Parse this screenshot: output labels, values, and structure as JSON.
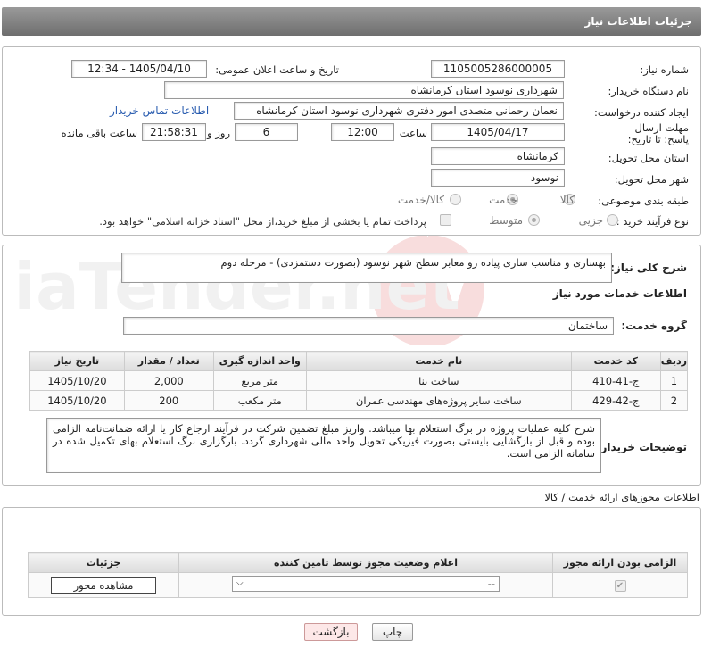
{
  "header": {
    "title": "جزئیات اطلاعات نیاز"
  },
  "form": {
    "need_no_label": "شماره نیاز:",
    "need_no": "1105005286000005",
    "announce_label": "تاریخ و ساعت اعلان عمومی:",
    "announce": "1405/04/10 - 12:34",
    "buyer_org_label": "نام دستگاه خریدار:",
    "buyer_org": "شهرداری نوسود استان کرمانشاه",
    "creator_label": "ایجاد کننده درخواست:",
    "creator": "نعمان رحمانی متصدی امور دفتری شهرداری نوسود استان کرمانشاه",
    "contact_link": "اطلاعات تماس خریدار",
    "deadline_label": "مهلت ارسال پاسخ: تا تاریخ:",
    "deadline_date": "1405/04/17",
    "time_label": "ساعت",
    "deadline_time": "12:00",
    "days": "6",
    "days_label": "روز و",
    "remaining": "21:58:31",
    "remaining_label": "ساعت باقی مانده",
    "province_label": "استان محل تحویل:",
    "province": "کرمانشاه",
    "city_label": "شهر محل تحویل:",
    "city": "نوسود",
    "category_label": "طبقه بندی موضوعی:",
    "cat_goods": "کالا",
    "cat_service": "خدمت",
    "cat_both": "کالا/خدمت",
    "process_label": "نوع فرآیند خرید :",
    "proc_small": "جزیی",
    "proc_medium": "متوسط",
    "payment_note": "پرداخت تمام یا بخشی از مبلغ خرید،از محل \"اسناد خزانه اسلامی\" خواهد بود."
  },
  "watermark": {
    "text": "AriaTender.net"
  },
  "description": {
    "label": "شرح کلی نیاز:",
    "value": "بهسازی و مناسب سازی پیاده رو معابر سطح شهر نوسود (بصورت دستمزدی) - مرحله دوم"
  },
  "services": {
    "title": "اطلاعات خدمات مورد نیاز",
    "group_label": "گروه خدمت:",
    "group": "ساختمان",
    "headers": [
      "ردیف",
      "کد خدمت",
      "نام خدمت",
      "واحد اندازه گیری",
      "تعداد / مقدار",
      "تاریخ نیاز"
    ],
    "rows": [
      [
        "1",
        "ج-41-410",
        "ساخت بنا",
        "متر مربع",
        "2,000",
        "1405/10/20"
      ],
      [
        "2",
        "ج-42-429",
        "ساخت سایر پروژه‌های مهندسی عمران",
        "متر مکعب",
        "200",
        "1405/10/20"
      ]
    ]
  },
  "buyer_notes": {
    "label": "توضیحات خریدار:",
    "value": "شرح کلیه عملیات پروژه در برگ استعلام بها میباشد. واریز مبلغ تضمین شرکت در فرآیند ارجاع کار یا ارائه ضمانت‌نامه الزامی بوده و قبل از بازگشایی بایستی بصورت فیزیکی تحویل واحد مالی شهرداری گردد. بارگزاری برگ استعلام بهای تکمیل شده در سامانه الزامی است."
  },
  "permits": {
    "title": "اطلاعات مجوزهای ارائه خدمت / کالا",
    "headers": [
      "الزامی بودن ارائه مجوز",
      "اعلام وضعیت مجوز توسط تامین کننده",
      "جزئیات"
    ],
    "select_value": "--",
    "view_button": "مشاهده مجوز"
  },
  "buttons": {
    "print": "چاپ",
    "back": "بازگشت"
  }
}
